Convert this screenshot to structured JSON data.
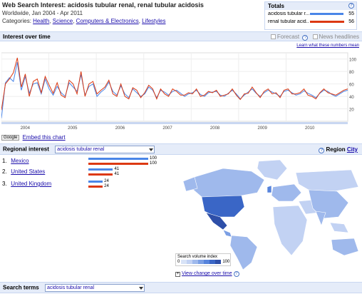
{
  "header": {
    "title": "Web Search Interest: acidosis tubular renal, renal tubular acidosis",
    "subtitle": "Worldwide, Jan 2004 - Apr 2011",
    "categories_label": "Categories:",
    "categories": [
      "Health",
      "Science",
      "Computers & Electronics",
      "Lifestyles"
    ]
  },
  "totals": {
    "title": "Totals",
    "help": "?",
    "rows": [
      {
        "label": "acidosis tubular r...",
        "value": "55",
        "color": "#4a86e8"
      },
      {
        "label": "renal tubular acid...",
        "value": "56",
        "color": "#dc3912"
      }
    ]
  },
  "interest": {
    "title": "Interest over time",
    "forecast_label": "Forecast",
    "news_label": "News headlines",
    "help": "?",
    "learn_link": "Learn what these numbers mean"
  },
  "chart_data": {
    "type": "line",
    "x_tick_labels": [
      "2004",
      "2005",
      "2006",
      "2007",
      "2008",
      "2009",
      "2010"
    ],
    "y_tick_labels": [
      "20",
      "40",
      "60",
      "80",
      "100"
    ],
    "ylim": [
      0,
      110
    ],
    "grid": true,
    "series": [
      {
        "name": "acidosis tubular renal",
        "color": "#4a86e8",
        "values": [
          5,
          62,
          70,
          64,
          95,
          50,
          72,
          45,
          60,
          62,
          44,
          68,
          52,
          42,
          56,
          46,
          40,
          62,
          55,
          48,
          75,
          42,
          56,
          60,
          40,
          47,
          52,
          63,
          48,
          42,
          57,
          44,
          38,
          52,
          46,
          40,
          44,
          55,
          50,
          38,
          50,
          47,
          42,
          48,
          50,
          45,
          40,
          44,
          46,
          50,
          43,
          40,
          46,
          47,
          48,
          42,
          40,
          45,
          50,
          44,
          36,
          42,
          47,
          52,
          45,
          40,
          46,
          50,
          47,
          44,
          40,
          48,
          50,
          46,
          42,
          44,
          49,
          45,
          42,
          38,
          45,
          50,
          48,
          43,
          40,
          44,
          48,
          50
        ]
      },
      {
        "name": "renal tubular acidosis",
        "color": "#dc3912",
        "values": [
          18,
          60,
          68,
          78,
          102,
          55,
          76,
          40,
          64,
          68,
          46,
          72,
          58,
          45,
          62,
          42,
          38,
          66,
          60,
          44,
          80,
          40,
          60,
          64,
          44,
          50,
          55,
          66,
          44,
          40,
          60,
          40,
          36,
          54,
          50,
          38,
          46,
          58,
          52,
          36,
          52,
          44,
          40,
          52,
          48,
          42,
          42,
          46,
          44,
          52,
          40,
          42,
          48,
          46,
          50,
          40,
          42,
          44,
          52,
          42,
          35,
          44,
          45,
          55,
          46,
          38,
          48,
          52,
          44,
          46,
          38,
          50,
          52,
          44,
          44,
          46,
          52,
          42,
          40,
          36,
          46,
          52,
          46,
          44,
          42,
          46,
          50,
          52
        ]
      }
    ]
  },
  "embed": {
    "badge": "Google",
    "link": "Embed this chart"
  },
  "regional": {
    "title": "Regional interest",
    "select_value": "acidosis tubular renal",
    "region_label": "Region",
    "city_label": "City",
    "rows": [
      {
        "rank": "1.",
        "name": "Mexico",
        "v1": "100",
        "v2": "100",
        "f1": 1.0,
        "f2": 1.0
      },
      {
        "rank": "2.",
        "name": "United States",
        "v1": "41",
        "v2": "41",
        "f1": 0.41,
        "f2": 0.41
      },
      {
        "rank": "3.",
        "name": "United Kingdom",
        "v1": "24",
        "v2": "24",
        "f1": 0.24,
        "f2": 0.24
      }
    ]
  },
  "map": {
    "legend_title": "Search volume index",
    "legend_min": "0",
    "legend_max": "100",
    "view_change_link": "View change over time",
    "help": "?",
    "colors": [
      "#d8e3f7",
      "#c2d2f3",
      "#9fb9ec",
      "#7b9fe4",
      "#5784dc",
      "#3a66c6",
      "#2e4fa8"
    ]
  },
  "search_terms": {
    "title": "Search terms",
    "select_value": "acidosis tubular renal"
  }
}
